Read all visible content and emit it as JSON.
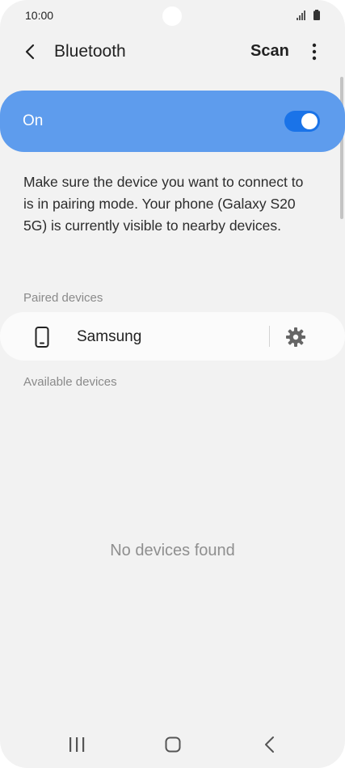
{
  "status_bar": {
    "time": "10:00",
    "icons": [
      "signal-icon",
      "battery-icon"
    ]
  },
  "header": {
    "title": "Bluetooth",
    "scan_label": "Scan",
    "icons": [
      "back-icon",
      "more-options-icon"
    ]
  },
  "bluetooth_toggle": {
    "label": "On",
    "enabled": true
  },
  "description": "Make sure the device you want to connect to is in pairing mode. Your phone (Galaxy S20 5G) is currently visible to nearby devices.",
  "paired_section": {
    "label": "Paired devices",
    "devices": [
      {
        "name": "Samsung",
        "icon": "phone-icon",
        "action_icon": "gear-icon"
      }
    ]
  },
  "available_section": {
    "label": "Available devices",
    "empty_message": "No devices found"
  },
  "nav_bar": {
    "icons": [
      "recent-apps-icon",
      "home-icon",
      "back-icon"
    ]
  },
  "colors": {
    "background": "#f2f2f2",
    "toggle_bar": "#5e9ced",
    "toggle_track": "#1a73e8"
  }
}
